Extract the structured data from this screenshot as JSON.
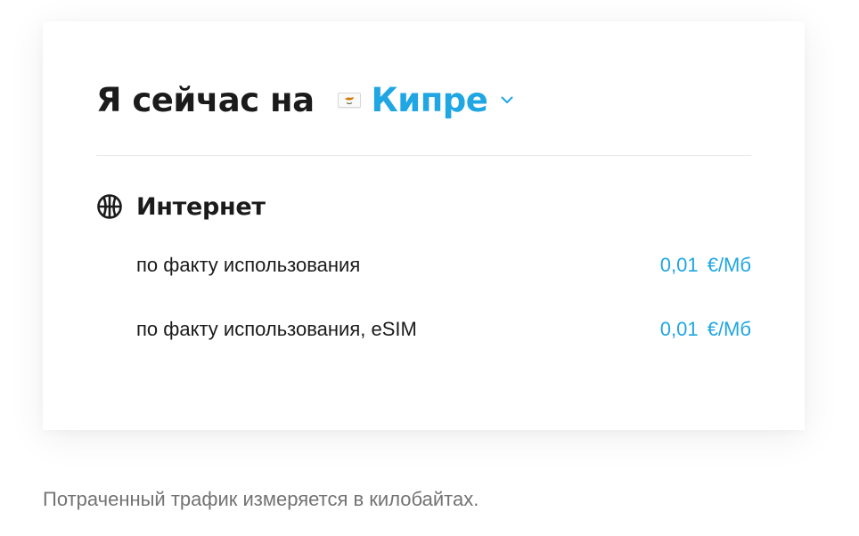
{
  "header": {
    "title_prefix": "Я сейчас на",
    "country": "Кипре",
    "flag_icon": "cyprus-flag-icon",
    "dropdown_icon": "chevron-down-icon"
  },
  "internet": {
    "icon": "globe-icon",
    "title": "Интернет",
    "rates": [
      {
        "label": "по факту использования",
        "price": "0,01 €/Мб"
      },
      {
        "label": "по факту использования, eSIM",
        "price": "0,01 €/Мб"
      }
    ]
  },
  "footnote": "Потраченный трафик измеряется в килобайтах.",
  "colors": {
    "accent": "#1fa6e3",
    "text": "#1b1b1b",
    "muted": "#737373",
    "divider": "#e5e5e5"
  }
}
